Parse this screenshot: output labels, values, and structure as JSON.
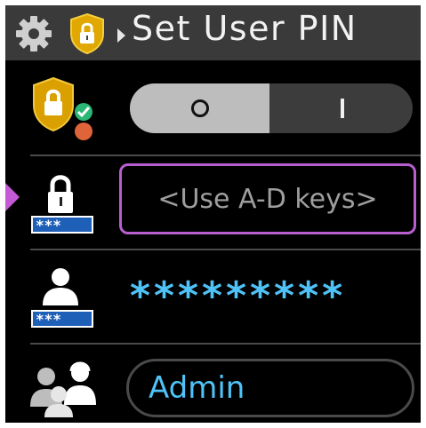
{
  "header": {
    "title": "Set User PIN",
    "icons": [
      "gear-icon",
      "security-shield-lock-icon",
      "breadcrumb-arrow-icon"
    ]
  },
  "rows": {
    "enable": {
      "icon": "shield-lock-status-icon",
      "toggle_off_glyph": "O",
      "toggle_on_glyph": "I",
      "state": "off"
    },
    "pin": {
      "icon": "lock-pin-icon",
      "placeholder": "<Use A-D keys>",
      "selected": true
    },
    "user_pin": {
      "icon": "user-pin-icon",
      "value": "*********"
    },
    "role": {
      "icon": "users-role-icon",
      "value": "Admin"
    }
  },
  "colors": {
    "accent_purple": "#b85fd0",
    "value_blue": "#4fc3f7",
    "title_bar": "#3a3a3a",
    "toggle_off": "#bdbdbd",
    "toggle_on": "#3c3c3c"
  }
}
